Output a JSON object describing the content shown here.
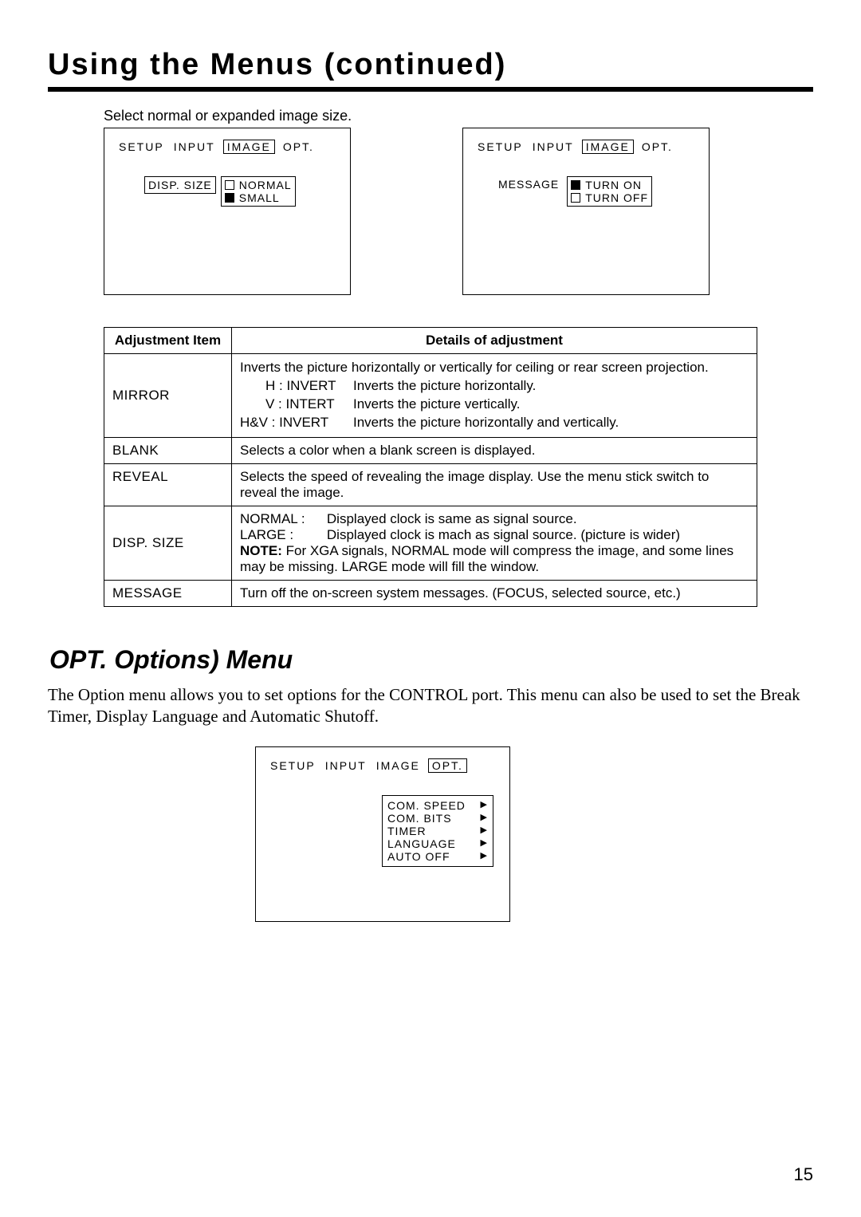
{
  "title": "Using  the  Menus  (continued)",
  "intro": "Select normal or expanded image size.",
  "osd1": {
    "tabs": {
      "setup": "SETUP",
      "input": "INPUT",
      "image": "IMAGE",
      "opt": "OPT."
    },
    "active": "image",
    "left_label": "DISP. SIZE",
    "opts": [
      {
        "mark": "empty",
        "label": "NORMAL"
      },
      {
        "mark": "filled",
        "label": "SMALL"
      }
    ]
  },
  "osd2": {
    "tabs": {
      "setup": "SETUP",
      "input": "INPUT",
      "image": "IMAGE",
      "opt": "OPT."
    },
    "active": "image",
    "left_label": "MESSAGE",
    "opts": [
      {
        "mark": "filled",
        "label": "TURN ON"
      },
      {
        "mark": "empty",
        "label": "TURN OFF"
      }
    ]
  },
  "table": {
    "h1": "Adjustment  Item",
    "h2": "Details  of  adjustment",
    "rows": {
      "mirror": {
        "name": "MIRROR",
        "line0": "Inverts the picture horizontally or vertically for ceiling or rear screen projection.",
        "l1a": "H : INVERT",
        "l1b": "Inverts the picture horizontally.",
        "l2a": "V : INTERT",
        "l2b": "Inverts the picture vertically.",
        "l3a": "H&V : INVERT",
        "l3b": "Inverts the picture horizontally and vertically."
      },
      "blank": {
        "name": "BLANK",
        "text": "Selects a color when a blank screen is displayed."
      },
      "reveal": {
        "name": "REVEAL",
        "text": "Selects the speed of revealing the image display. Use the menu stick switch to reveal the image."
      },
      "disp": {
        "name": "DISP. SIZE",
        "n_label": "NORMAL :",
        "n_text": "Displayed clock is same as signal source.",
        "l_label": "LARGE :",
        "l_text": "Displayed clock is mach as signal source. (picture is wider)",
        "note_label": "NOTE:",
        "note_text": " For XGA signals, NORMAL mode will compress the image, and some lines may be missing. LARGE mode will fill the window."
      },
      "message": {
        "name": "MESSAGE",
        "text": "Turn off the on-screen system messages. (FOCUS, selected source, etc.)"
      }
    }
  },
  "sub_title": "OPT. Options) Menu",
  "body_text": "The Option menu allows you to set options for the CONTROL port. This menu can also be used to set the Break Timer, Display Language and Automatic Shutoff.",
  "osd3": {
    "tabs": {
      "setup": "SETUP",
      "input": "INPUT",
      "image": "IMAGE",
      "opt": "OPT."
    },
    "active": "opt",
    "items": [
      "COM. SPEED",
      "COM. BITS",
      "TIMER",
      "LANGUAGE",
      "AUTO OFF"
    ]
  },
  "page_number": "15"
}
